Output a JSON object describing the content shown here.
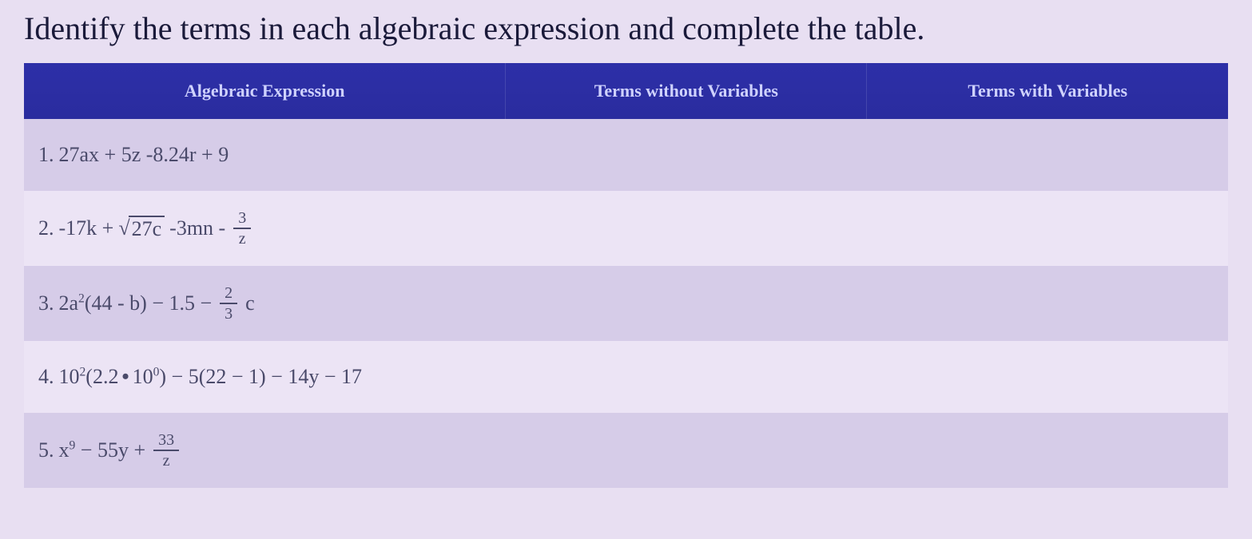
{
  "instruction": "Identify the terms in each algebraic expression and complete the table.",
  "headers": {
    "expression": "Algebraic Expression",
    "without": "Terms without Variables",
    "with": "Terms with Variables"
  },
  "rows": [
    {
      "num": "1.",
      "parts": {
        "a": "27ax + 5z -8.24r + 9"
      },
      "without": "",
      "with": ""
    },
    {
      "num": "2.",
      "parts": {
        "a": "-17k +",
        "rad": "27c",
        "b": "-3mn -",
        "frac_top": "3",
        "frac_bot": "z"
      },
      "without": "",
      "with": ""
    },
    {
      "num": "3.",
      "parts": {
        "a": "2a",
        "sup1": "2",
        "b": "(44 - b) − 1.5 −",
        "frac_top": "2",
        "frac_bot": "3",
        "c": "c"
      },
      "without": "",
      "with": ""
    },
    {
      "num": "4.",
      "parts": {
        "a": "10",
        "sup1": "2",
        "b": "(2.2",
        "dot": "•",
        "c": "10",
        "sup2": "0",
        "d": ") − 5(22 − 1) − 14y − 17"
      },
      "without": "",
      "with": ""
    },
    {
      "num": "5.",
      "parts": {
        "a": "x",
        "sup1": "9",
        "b": "− 55y +",
        "frac_top": "33",
        "frac_bot": "z"
      },
      "without": "",
      "with": ""
    }
  ]
}
